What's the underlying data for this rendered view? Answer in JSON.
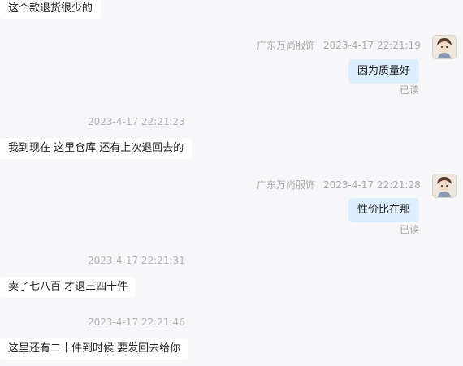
{
  "messages": {
    "m1": {
      "text": "这个款退货很少的"
    },
    "m2": {
      "sender": "广东万尚服饰",
      "time": "2023-4-17 22:21:19",
      "text": "因为质量好",
      "status": "已读"
    },
    "m3": {
      "time": "2023-4-17 22:21:23",
      "text": "我到现在 这里仓库  还有上次退回去的"
    },
    "m4": {
      "sender": "广东万尚服饰",
      "time": "2023-4-17 22:21:28",
      "text": "性价比在那",
      "status": "已读"
    },
    "m5": {
      "time": "2023-4-17 22:21:31",
      "text": "卖了七八百 才退三四十件"
    },
    "m6": {
      "time": "2023-4-17 22:21:46",
      "text": "这里还有二十件到时候 要发回去给你"
    }
  },
  "icons": {
    "avatar": "avatar-icon"
  },
  "colors": {
    "background": "#f7f7f9",
    "outgoing_bubble": "#ddeeff",
    "incoming_bubble": "#ffffff"
  }
}
